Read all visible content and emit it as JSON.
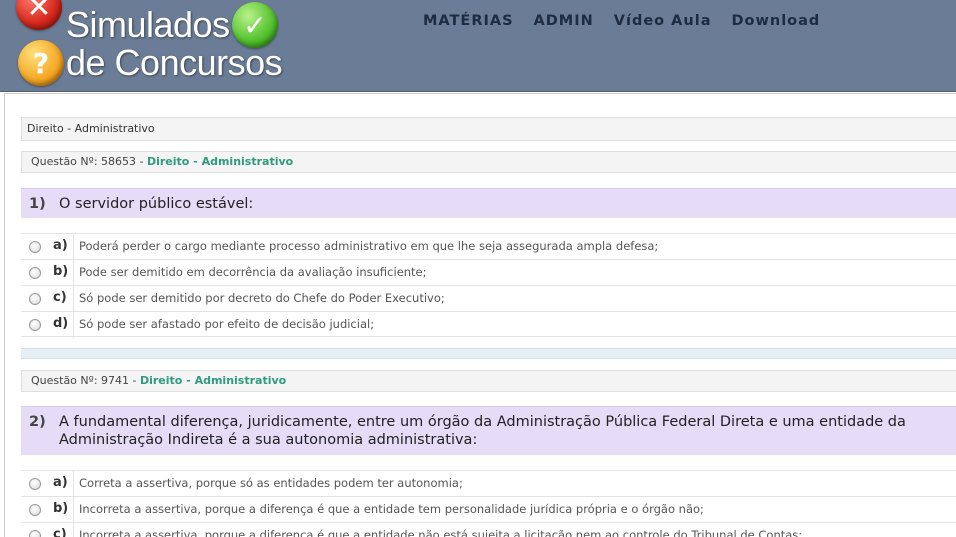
{
  "header": {
    "logo_line1": "Simulados",
    "logo_line2": "de Concursos",
    "logo_icons": [
      "x-mark-icon",
      "check-mark-icon",
      "question-mark-icon"
    ],
    "nav": [
      "MATÉRIAS",
      "ADMIN",
      "Vídeo Aula",
      "Download"
    ]
  },
  "breadcrumb": "Direito - Administrativo",
  "questions": [
    {
      "meta_prefix": "Questão Nº: 58653 - ",
      "subject": "Direito - Administrativo",
      "number": "1)",
      "text": "O servidor público estável:",
      "alternatives": [
        {
          "letter": "a)",
          "text": "Poderá perder o cargo mediante processo administrativo em que lhe seja assegurada ampla defesa;"
        },
        {
          "letter": "b)",
          "text": "Pode ser demitido em decorrência da avaliação insuficiente;"
        },
        {
          "letter": "c)",
          "text": "Só pode ser demitido por decreto do Chefe do Poder Executivo;"
        },
        {
          "letter": "d)",
          "text": "Só pode ser afastado por efeito de decisão judicial;"
        }
      ]
    },
    {
      "meta_prefix": "Questão Nº: 9741 - ",
      "subject": "Direito - Administrativo",
      "number": "2)",
      "text": "A fundamental diferença, juridicamente, entre um órgão da Administração Pública Federal Direta e uma entidade da Administração Indireta é a sua autonomia administrativa:",
      "alternatives": [
        {
          "letter": "a)",
          "text": "Correta a assertiva, porque só as entidades podem ter autonomia;"
        },
        {
          "letter": "b)",
          "text": "Incorreta a assertiva, porque a diferença é que a entidade tem personalidade jurídica própria e o órgão não;"
        },
        {
          "letter": "c)",
          "text": "Incorreta a assertiva, porque a diferença é que a entidade não está sujeita a licitação nem ao controle do Tribunal de Contas;"
        }
      ]
    }
  ],
  "colors": {
    "header_bg": "#6b7d96",
    "nav_text": "#1e2b40",
    "question_bg": "#e6dcf8",
    "subject_link": "#2f9a7e"
  }
}
